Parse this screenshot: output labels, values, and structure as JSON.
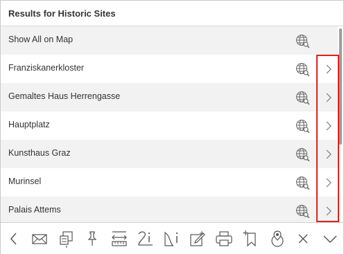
{
  "header": {
    "title": "Results for Historic Sites"
  },
  "list": {
    "items": [
      {
        "label": "Show All on Map",
        "icon": "globe-search-icon",
        "has_chevron": false
      },
      {
        "label": "Franziskanerkloster",
        "icon": "globe-search-icon",
        "has_chevron": true
      },
      {
        "label": "Gemaltes Haus Herrengasse",
        "icon": "globe-search-icon",
        "has_chevron": true
      },
      {
        "label": "Hauptplatz",
        "icon": "globe-search-icon",
        "has_chevron": true
      },
      {
        "label": "Kunsthaus Graz",
        "icon": "globe-search-icon",
        "has_chevron": true
      },
      {
        "label": "Murinsel",
        "icon": "globe-search-icon",
        "has_chevron": true
      },
      {
        "label": "Palais Attems",
        "icon": "globe-search-icon",
        "has_chevron": true
      }
    ]
  },
  "toolbar": {
    "icons": [
      "back-icon",
      "envelope-icon",
      "bookmarks-icon",
      "pin-icon",
      "measure-icon",
      "route-info-icon",
      "elevation-info-icon",
      "edit-icon",
      "print-icon",
      "add-bookmark-icon",
      "location-icon",
      "close-icon",
      "collapse-icon"
    ]
  },
  "colors": {
    "highlight": "#e0201c",
    "row_alt": "#f2f2f2",
    "icon": "#555555"
  }
}
